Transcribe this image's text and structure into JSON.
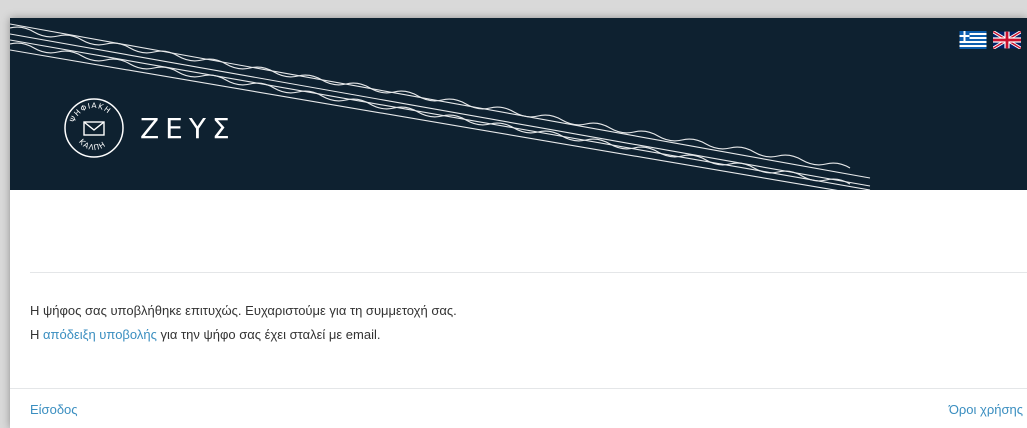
{
  "header": {
    "logo_name": "ΖΕΥΣ",
    "seal_text_top": "ΨΗΦΙΑΚΗ",
    "seal_text_bottom": "ΚΑΛΠΗ",
    "seal_icon": "envelope-icon",
    "flags": [
      {
        "name": "greek-flag-icon",
        "colors": [
          "#0d5eaf",
          "#ffffff"
        ]
      },
      {
        "name": "uk-flag-icon",
        "colors": [
          "#012169",
          "#ffffff",
          "#c8102e"
        ]
      }
    ]
  },
  "main": {
    "success_message": "Η ψήφος σας υποβλήθηκε επιτυχώς. Ευχαριστούμε για τη συμμετοχή σας.",
    "receipt_prefix": "Η ",
    "receipt_link": "απόδειξη υποβολής",
    "receipt_suffix": " για την ψήφο σας έχει σταλεί με email."
  },
  "footer": {
    "login_link": "Είσοδος",
    "terms_link": "Όροι χρήσης"
  },
  "colors": {
    "header_bg": "#0e2130",
    "link": "#3a8ec0",
    "text": "#333333"
  }
}
